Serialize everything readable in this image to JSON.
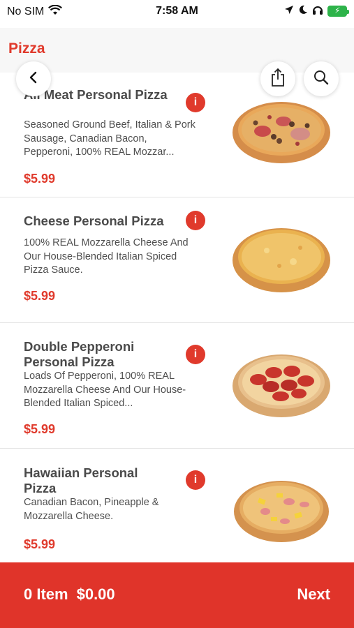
{
  "status_bar": {
    "carrier": "No SIM",
    "time": "7:58 AM"
  },
  "header": {
    "title": "Pizza"
  },
  "items": [
    {
      "name": "All Meat Personal Pizza",
      "description": "Seasoned Ground Beef, Italian & Pork Sausage, Canadian Bacon, Pepperoni, 100% REAL Mozzar...",
      "price": "$5.99",
      "pizza_style": "meat"
    },
    {
      "name": "Cheese Personal Pizza",
      "description": "100% REAL Mozzarella Cheese And Our House-Blended Italian Spiced Pizza Sauce.",
      "price": "$5.99",
      "pizza_style": "cheese"
    },
    {
      "name": "Double Pepperoni Personal Pizza",
      "description": "Loads Of Pepperoni, 100% REAL Mozzarella Cheese And Our House-Blended Italian Spiced...",
      "price": "$5.99",
      "pizza_style": "pepperoni"
    },
    {
      "name": "Hawaiian Personal Pizza",
      "description": "Canadian Bacon, Pineapple & Mozzarella Cheese.",
      "price": "$5.99",
      "pizza_style": "hawaiian"
    }
  ],
  "cart": {
    "count_label": "0 Item",
    "total": "$0.00",
    "next_label": "Next"
  },
  "icons": {
    "back": "chevron-left-icon",
    "share": "share-icon",
    "search": "search-icon",
    "info": "info-icon"
  },
  "colors": {
    "accent": "#e03a2c",
    "bottom_bar": "#e0342a"
  }
}
